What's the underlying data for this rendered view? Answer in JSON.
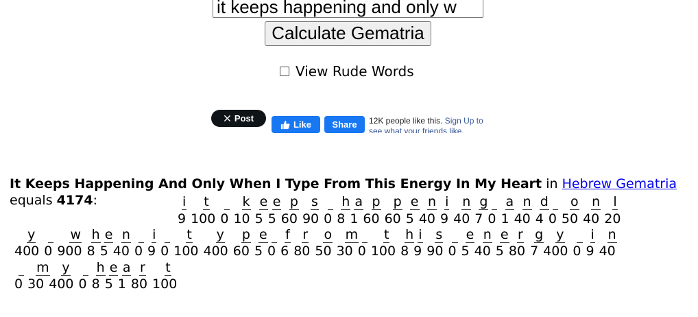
{
  "search": {
    "value": "it keeps happening and only w"
  },
  "calculate_label": "Calculate Gematria",
  "rude_words_label": "View Rude Words",
  "social": {
    "x_post_label": "Post",
    "fb_like_label": "Like",
    "fb_share_label": "Share",
    "fb_text": "12K people like this.",
    "fb_link": "Sign Up to see what your friends like."
  },
  "result": {
    "phrase": "It Keeps Happening And Only When I Type From This Energy In My Heart",
    "in_text": "in",
    "cipher_link": "Hebrew Gematria",
    "equals_text": "equals",
    "total": "4174",
    "colon": ":"
  },
  "breakdown": [
    [
      [
        "i",
        "9"
      ],
      [
        "t",
        "100"
      ],
      [
        "_",
        "0"
      ],
      [
        "k",
        "10"
      ],
      [
        "e",
        "5"
      ],
      [
        "e",
        "5"
      ],
      [
        "p",
        "60"
      ],
      [
        "s",
        "90"
      ],
      [
        "_",
        "0"
      ],
      [
        "h",
        "8"
      ],
      [
        "a",
        "1"
      ],
      [
        "p",
        "60"
      ],
      [
        "p",
        "60"
      ],
      [
        "e",
        "5"
      ],
      [
        "n",
        "40"
      ],
      [
        "i",
        "9"
      ],
      [
        "n",
        "40"
      ],
      [
        "g",
        "7"
      ],
      [
        "_",
        "0"
      ],
      [
        "a",
        "1"
      ],
      [
        "n",
        "40"
      ],
      [
        "d",
        "4"
      ],
      [
        "_",
        "0"
      ],
      [
        "o",
        "50"
      ],
      [
        "n",
        "40"
      ],
      [
        "l",
        "20"
      ]
    ],
    [
      [
        "y",
        "400"
      ],
      [
        "_",
        "0"
      ],
      [
        "w",
        "900"
      ],
      [
        "h",
        "8"
      ],
      [
        "e",
        "5"
      ],
      [
        "n",
        "40"
      ],
      [
        "_",
        "0"
      ],
      [
        "i",
        "9"
      ],
      [
        "_",
        "0"
      ],
      [
        "t",
        "100"
      ],
      [
        "y",
        "400"
      ],
      [
        "p",
        "60"
      ],
      [
        "e",
        "5"
      ],
      [
        "_",
        "0"
      ],
      [
        "f",
        "6"
      ],
      [
        "r",
        "80"
      ],
      [
        "o",
        "50"
      ],
      [
        "m",
        "30"
      ],
      [
        "_",
        "0"
      ],
      [
        "t",
        "100"
      ],
      [
        "h",
        "8"
      ],
      [
        "i",
        "9"
      ],
      [
        "s",
        "90"
      ],
      [
        "_",
        "0"
      ],
      [
        "e",
        "5"
      ],
      [
        "n",
        "40"
      ],
      [
        "e",
        "5"
      ],
      [
        "r",
        "80"
      ],
      [
        "g",
        "7"
      ],
      [
        "y",
        "400"
      ],
      [
        "_",
        "0"
      ],
      [
        "i",
        "9"
      ],
      [
        "n",
        "40"
      ]
    ],
    [
      [
        "_",
        "0"
      ],
      [
        "m",
        "30"
      ],
      [
        "y",
        "400"
      ],
      [
        "_",
        "0"
      ],
      [
        "h",
        "8"
      ],
      [
        "e",
        "5"
      ],
      [
        "a",
        "1"
      ],
      [
        "r",
        "80"
      ],
      [
        "t",
        "100"
      ]
    ]
  ]
}
